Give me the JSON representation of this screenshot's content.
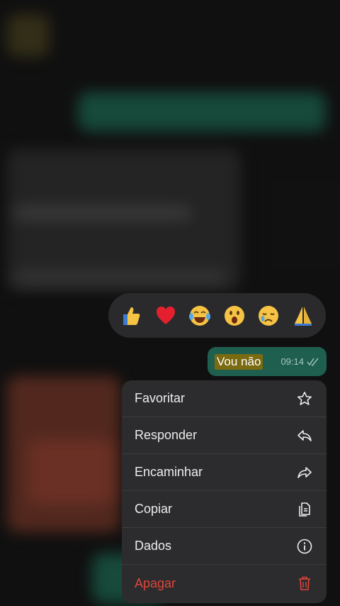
{
  "reactions": [
    {
      "emoji": "thumbs-up",
      "label": "👍"
    },
    {
      "emoji": "red-heart",
      "label": "❤️"
    },
    {
      "emoji": "face-with-tears-of-joy",
      "label": "😂"
    },
    {
      "emoji": "face-with-open-mouth",
      "label": "😮"
    },
    {
      "emoji": "crying-face",
      "label": "😢"
    },
    {
      "emoji": "folded-hands",
      "label": "🙏"
    }
  ],
  "message": {
    "text": "Vou não",
    "time": "09:14",
    "status": "read"
  },
  "menu": {
    "items": [
      {
        "label": "Favoritar",
        "icon": "star-icon"
      },
      {
        "label": "Responder",
        "icon": "reply-icon"
      },
      {
        "label": "Encaminhar",
        "icon": "forward-icon"
      },
      {
        "label": "Copiar",
        "icon": "copy-icon"
      },
      {
        "label": "Dados",
        "icon": "info-icon"
      },
      {
        "label": "Apagar",
        "icon": "trash-icon",
        "destructive": true
      }
    ]
  },
  "colors": {
    "bubble": "#1f5f4f",
    "menu_background": "#2c2c2e",
    "destructive": "#e0453a"
  }
}
